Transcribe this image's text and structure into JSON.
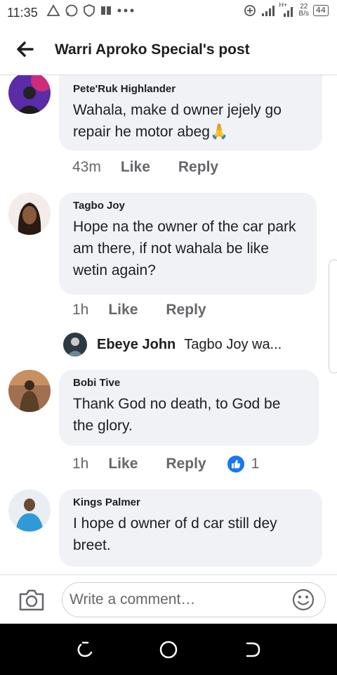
{
  "status_bar": {
    "time": "11:35",
    "left_icons": [
      "warning-triangle-icon",
      "whatsapp-icon",
      "shield-icon",
      "news-icon",
      "more-dots-icon"
    ],
    "net_speed_value": "22",
    "net_speed_unit": "B/s",
    "network_badge": "H+",
    "battery": "44"
  },
  "header": {
    "title": "Warri Aproko Special's post",
    "back_icon": "arrow-left-icon"
  },
  "comments": [
    {
      "author": "Pete'Ruk Highlander",
      "text": "Wahala, make d owner jejely go repair he motor abeg🙏",
      "time": "43m",
      "like": "Like",
      "reply": "Reply"
    },
    {
      "author": "Tagbo Joy",
      "text": "Hope na the owner of the car park am there, if not wahala be like wetin again?",
      "time": "1h",
      "like": "Like",
      "reply": "Reply"
    },
    {
      "author": "Bobi Tive",
      "text": "Thank God no death, to God be the glory.",
      "time": "1h",
      "like": "Like",
      "reply": "Reply",
      "reaction_count": "1"
    },
    {
      "author": "Kings Palmer",
      "text": "I hope d owner of d car still dey breet."
    }
  ],
  "reply_preview": {
    "name": "Ebeye John",
    "snippet": "Tagbo Joy wa..."
  },
  "composer": {
    "placeholder": "Write a comment…",
    "camera_icon": "camera-icon",
    "emoji_icon": "smiley-icon"
  },
  "navbar": {
    "buttons": [
      "recents-icon",
      "home-icon",
      "back-nav-icon"
    ]
  },
  "colors": {
    "bubble": "#f0f2f5",
    "like_blue": "#1877f2",
    "secondary_text": "#65676b"
  }
}
